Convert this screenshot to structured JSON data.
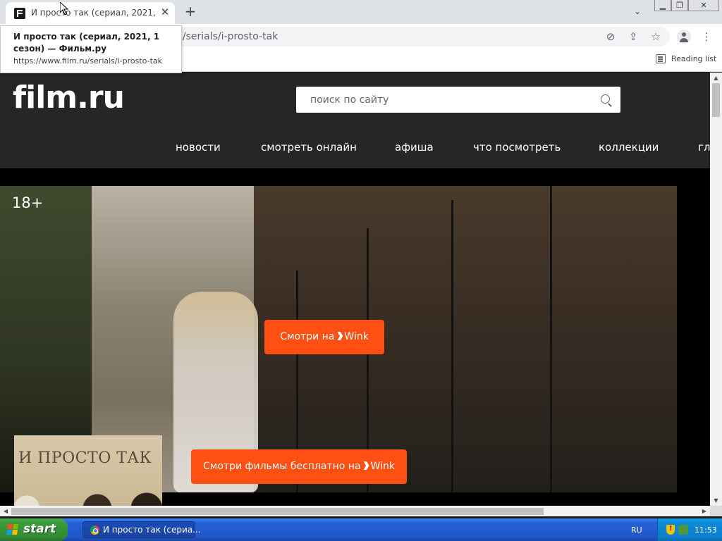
{
  "browser": {
    "tab": {
      "title": "И просто так (сериал, 2021, 1 сезон) — Фильм.ру",
      "close_glyph": "✕",
      "favicon": "film-ru-favicon"
    },
    "new_tab_glyph": "+",
    "tab_search_glyph": "⌄",
    "window_controls": {
      "minimize": "▁",
      "restore": "❐",
      "close": "✕"
    },
    "url": "https://www.film.ru/serials/i-prosto-tak",
    "url_visible_fragment": "u/serials/i-prosto-tak",
    "toolbar_icons": [
      "eye-off-icon",
      "share-icon",
      "star-icon",
      "profile-icon",
      "more-icon"
    ],
    "toolbar_glyphs": {
      "eye_off": "⊘",
      "share": "⇪",
      "star": "☆",
      "more": "⋮"
    },
    "reading_list_label": "Reading list"
  },
  "tooltip": {
    "title": "И просто так (сериал, 2021, 1 сезон) — Фильм.ру",
    "url": "https://www.film.ru/serials/i-prosto-tak"
  },
  "site": {
    "logo": "film.ru",
    "search_placeholder": "поиск по сайту",
    "nav": [
      "новости",
      "смотреть онлайн",
      "афиша",
      "что посмотреть",
      "коллекции",
      "гл"
    ],
    "age_rating": "18+",
    "wink_button_1": {
      "prefix": "Смотри на",
      "brand": "Wink"
    },
    "wink_button_2": {
      "prefix": "Смотри фильмы бесплатно на",
      "brand": "Wink"
    },
    "poster_title": "И ПРОСТО ТАК",
    "accent_color": "#ff4f12"
  },
  "scrollbars": {
    "up": "▲",
    "down": "▼",
    "left": "◀",
    "right": "▶"
  },
  "taskbar": {
    "start_label": "start",
    "task_label": "И просто так (сериа...",
    "language": "RU",
    "clock": "11:53"
  }
}
